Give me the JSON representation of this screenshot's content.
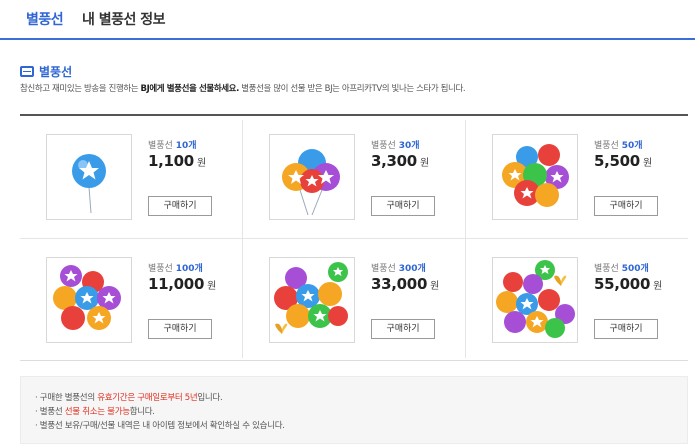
{
  "tabs": [
    {
      "label": "별풍선",
      "active": true
    },
    {
      "label": "내 별풍선 정보",
      "active": false
    }
  ],
  "section": {
    "title": "별풍선",
    "desc_part1": "참신하고 재미있는 방송을 진행하는 ",
    "desc_bold": "BJ에게 별풍선을 선물하세요.",
    "desc_part2": " 별풍선을 많이 선물 받은 BJ는 아프리카TV의 빛나는 스타가 됩니다."
  },
  "products": [
    {
      "label": "별풍선",
      "count": "10개",
      "price": "1,100",
      "unit": "원",
      "button": "구매하기"
    },
    {
      "label": "별풍선",
      "count": "30개",
      "price": "3,300",
      "unit": "원",
      "button": "구매하기"
    },
    {
      "label": "별풍선",
      "count": "50개",
      "price": "5,500",
      "unit": "원",
      "button": "구매하기"
    },
    {
      "label": "별풍선",
      "count": "100개",
      "price": "11,000",
      "unit": "원",
      "button": "구매하기"
    },
    {
      "label": "별풍선",
      "count": "300개",
      "price": "33,000",
      "unit": "원",
      "button": "구매하기"
    },
    {
      "label": "별풍선",
      "count": "500개",
      "price": "55,000",
      "unit": "원",
      "button": "구매하기"
    }
  ],
  "notice": {
    "line1_a": "· 구매한 별풍선의 ",
    "line1_red": "유효기간은 구매일로부터 5년",
    "line1_b": "입니다.",
    "line2_a": "· 별풍선 ",
    "line2_red": "선물 취소는 불가능",
    "line2_b": "합니다.",
    "line3": "· 별풍선 보유/구매/선물 내역은 내 아이템 정보에서 확인하실 수 있습니다."
  },
  "colors": {
    "accent": "#2f66d3",
    "notice_red": "#e0301e",
    "balloon_blue": "#3a9be8",
    "balloon_orange": "#f5a623",
    "balloon_red": "#e8403a",
    "balloon_purple": "#a64fd6",
    "balloon_green": "#3cc44a"
  },
  "icons": {
    "section": "balloon-list-icon",
    "product": "star-balloon-icon",
    "butterfly": "butterfly-icon"
  }
}
